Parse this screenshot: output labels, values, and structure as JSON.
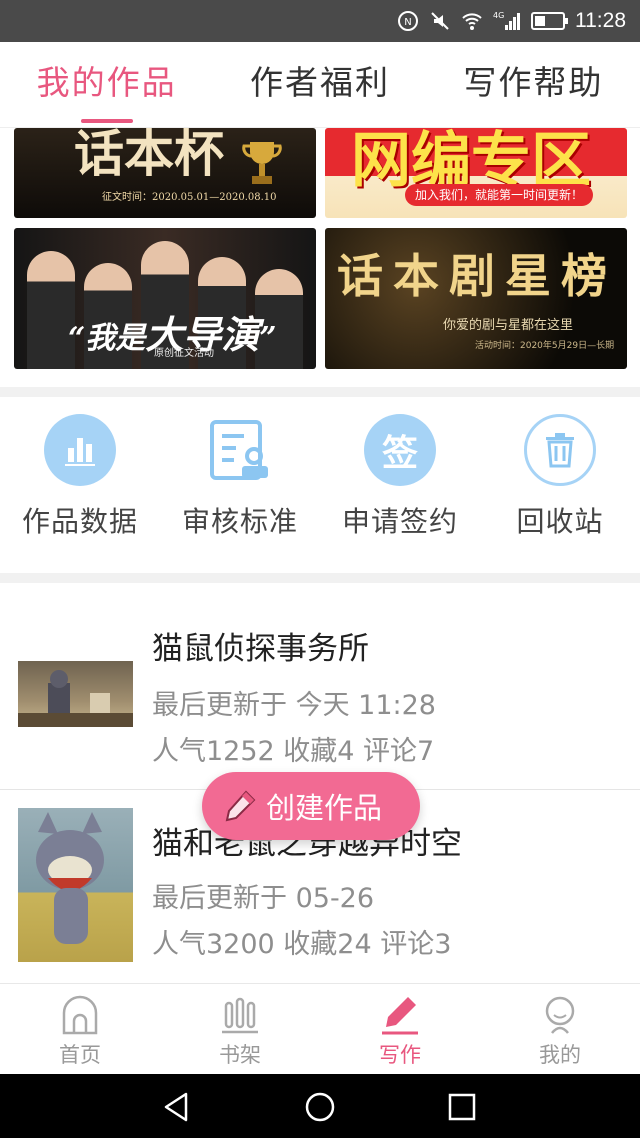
{
  "status_bar": {
    "time": "11:28",
    "network": "4G",
    "icons": [
      "nfc-icon",
      "mute-icon",
      "wifi-icon",
      "signal-icon",
      "battery-icon"
    ]
  },
  "tabs": [
    {
      "label": "我的作品",
      "active": true
    },
    {
      "label": "作者福利",
      "active": false
    },
    {
      "label": "写作帮助",
      "active": false
    }
  ],
  "banners": {
    "b1": {
      "big": "话本杯",
      "small": "征文时间：2020.05.01—2020.08.10"
    },
    "b2": {
      "big": "网编专区",
      "pill": "加入我们，就能第一时间更新！"
    },
    "b3": {
      "big_prefix": "“我是",
      "big_main": "大导演",
      "big_suffix": "”",
      "small": "原创征文活动"
    },
    "b4": {
      "big": "话本剧星榜",
      "small": "你爱的剧与星都在这里",
      "tiny": "活动时间：2020年5月29日—长期"
    }
  },
  "actions": [
    {
      "label": "作品数据",
      "icon": "bar-chart-icon"
    },
    {
      "label": "审核标准",
      "icon": "review-doc-icon"
    },
    {
      "label": "申请签约",
      "icon": "sign-icon",
      "glyph": "签"
    },
    {
      "label": "回收站",
      "icon": "trash-icon"
    }
  ],
  "works": [
    {
      "title": "猫鼠侦探事务所",
      "updated": "最后更新于 今天 11:28",
      "stats": "人气1252 收藏4 评论7"
    },
    {
      "title": "猫和老鼠之穿越异时空",
      "updated": "最后更新于 05-26",
      "stats": "人气3200 收藏24 评论3"
    }
  ],
  "fab": {
    "label": "创建作品"
  },
  "bottom_nav": [
    {
      "label": "首页",
      "active": false
    },
    {
      "label": "书架",
      "active": false
    },
    {
      "label": "写作",
      "active": true
    },
    {
      "label": "我的",
      "active": false
    }
  ],
  "colors": {
    "accent": "#e8577f",
    "fab": "#f26a93",
    "icon_blue": "#a6d3f6"
  }
}
